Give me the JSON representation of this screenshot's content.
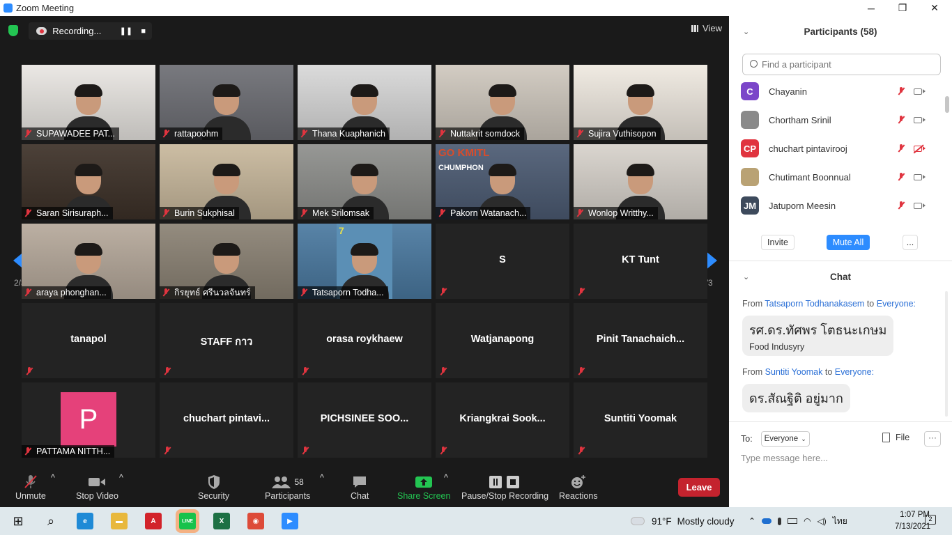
{
  "window": {
    "title": "Zoom Meeting",
    "controls": [
      "─",
      "❐",
      "✕"
    ]
  },
  "recording": {
    "label": "Recording...",
    "pause": "❚❚",
    "stop": "■"
  },
  "view": {
    "label": "View"
  },
  "pagination": {
    "left": "2/3",
    "right": "2/3"
  },
  "tiles": [
    {
      "name": "SUPAWADEE PAT...",
      "video": true,
      "bg": "#e9e6e2",
      "muted": true
    },
    {
      "name": "rattapoohm",
      "video": true,
      "bg": "#6d6e74",
      "muted": true
    },
    {
      "name": "Thana Kuaphanich",
      "video": true,
      "bg": "#d8d8d8",
      "muted": true
    },
    {
      "name": "Nuttakrit somdock",
      "video": true,
      "bg": "#cfc8be",
      "muted": true
    },
    {
      "name": "Sujira Vuthisopon",
      "video": true,
      "bg": "#efe9e0",
      "muted": true
    },
    {
      "name": "Saran Sirisuraph...",
      "video": true,
      "bg": "#3d3128",
      "muted": true
    },
    {
      "name": "Burin Sukphisal",
      "video": true,
      "bg": "#c8b89c",
      "muted": true
    },
    {
      "name": "Mek Srilomsak",
      "video": true,
      "bg": "#8e8f8c",
      "muted": true
    },
    {
      "name": "Pakorn Watanach...",
      "video": true,
      "bg": "#4c5b73",
      "muted": true
    },
    {
      "name": "Wonlop Writthy...",
      "video": true,
      "bg": "#d7d2cb",
      "muted": true
    },
    {
      "name": "araya phonghan...",
      "video": true,
      "bg": "#b6a99b",
      "muted": true
    },
    {
      "name": "กิรยุทธ์ ศรีนวลจันทร์",
      "video": true,
      "bg": "#8b8274",
      "muted": true
    },
    {
      "name": "Tatsaporn Todha...",
      "video": true,
      "bg": "#4a79a0",
      "muted": true
    },
    {
      "name": "S",
      "video": false,
      "muted": true
    },
    {
      "name": "KT Tunt",
      "video": false,
      "muted": true
    },
    {
      "name": "tanapol",
      "video": false,
      "muted": true
    },
    {
      "name": "STAFF กาว",
      "video": false,
      "muted": true
    },
    {
      "name": "orasa roykhaew",
      "video": false,
      "muted": true
    },
    {
      "name": "Watjanapong",
      "video": false,
      "muted": true
    },
    {
      "name": "Pinit  Tanachaich...",
      "video": false,
      "muted": true
    },
    {
      "name": "PATTAMA NITTH...",
      "video": false,
      "avatar": "P",
      "muted": true
    },
    {
      "name": "chuchart  pintavi...",
      "video": false,
      "muted": true
    },
    {
      "name": "PICHSINEE  SOO...",
      "video": false,
      "muted": true
    },
    {
      "name": "Kriangkrai  Sook...",
      "video": false,
      "muted": true
    },
    {
      "name": "Suntiti Yoomak",
      "video": false,
      "muted": true
    }
  ],
  "gokmitl": {
    "top": "GO KMITL",
    "bottom": "CHUMPHON"
  },
  "conf_banner": {
    "text": "7"
  },
  "toolbar": {
    "unmute": "Unmute",
    "stop_video": "Stop Video",
    "security": "Security",
    "participants": "Participants",
    "participants_count": "58",
    "chat": "Chat",
    "share_screen": "Share Screen",
    "pause_stop_recording": "Pause/Stop Recording",
    "reactions": "Reactions",
    "leave": "Leave",
    "caret": "^"
  },
  "participants_panel": {
    "title": "Participants (58)",
    "collapse": "⌄",
    "search_placeholder": "Find a participant",
    "list": [
      {
        "initials": "C",
        "color": "#7b46c9",
        "name": "Chayanin",
        "cam_off": false
      },
      {
        "initials": "",
        "color": "#8a8a8a",
        "name": "Chortham Srinil",
        "cam_off": false
      },
      {
        "initials": "CP",
        "color": "#e0343f",
        "name": "chuchart pintavirooj",
        "cam_off": true
      },
      {
        "initials": "",
        "color": "#b9a274",
        "name": "Chutimant Boonnual",
        "cam_off": false
      },
      {
        "initials": "JM",
        "color": "#3d4a5c",
        "name": "Jatuporn Meesin",
        "cam_off": false
      }
    ],
    "invite": "Invite",
    "mute_all": "Mute All",
    "more": "..."
  },
  "chat_panel": {
    "title": "Chat",
    "from": "From",
    "to": "to",
    "messages": [
      {
        "sender": "Tatsaporn Todhanakasem",
        "recipient": "Everyone:",
        "big": "รศ.ดร.ทัศพร โตธนะเกษม",
        "small": "Food Indusyry"
      },
      {
        "sender": "Suntiti Yoomak",
        "recipient": "Everyone:",
        "big": "ดร.สัณฐิติ อยู่มาก",
        "small": ""
      }
    ],
    "to_label": "To:",
    "to_value": "Everyone",
    "file": "File",
    "more": "···",
    "placeholder": "Type message here..."
  },
  "taskbar": {
    "apps": [
      {
        "name": "windows-start-icon",
        "label": "⊞",
        "color": "#111"
      },
      {
        "name": "search-icon",
        "label": "⌕",
        "color": "#111"
      },
      {
        "name": "edge-icon",
        "label": "e",
        "color": "#1f8ad6"
      },
      {
        "name": "file-explorer-icon",
        "label": "▬",
        "color": "#e8b83c"
      },
      {
        "name": "acrobat-icon",
        "label": "A",
        "color": "#d2232a"
      },
      {
        "name": "line-icon",
        "label": "LINE",
        "color": "#17c24b"
      },
      {
        "name": "excel-icon",
        "label": "X",
        "color": "#1d7044"
      },
      {
        "name": "chrome-icon",
        "label": "◉",
        "color": "#dd4b39"
      },
      {
        "name": "zoom-icon",
        "label": "▶",
        "color": "#2d8cff"
      }
    ],
    "weather_temp": "91°F",
    "weather_text": "Mostly cloudy",
    "lang": "ไทย",
    "time": "1:07 PM",
    "date": "7/13/2021",
    "notif_count": "2"
  }
}
